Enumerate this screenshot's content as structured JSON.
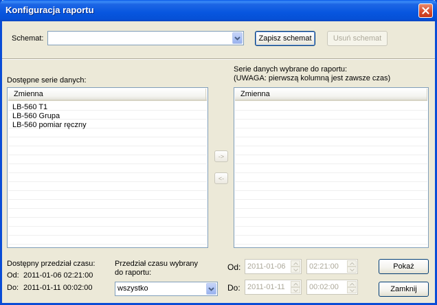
{
  "window": {
    "title": "Konfiguracja raportu"
  },
  "schema": {
    "label": "Schemat:",
    "value": "",
    "save_button": "Zapisz schemat",
    "delete_button": "Usuń schemat"
  },
  "available": {
    "title": "Dostępne serie danych:",
    "column": "Zmienna",
    "items": [
      "LB-560 T1",
      "LB-560 Grupa",
      "LB-560 pomiar ręczny"
    ]
  },
  "selected": {
    "title_line1": "Serie danych wybrane do raportu:",
    "title_line2": "(UWAGA: pierwszą kolumną jest zawsze czas)",
    "column": "Zmienna",
    "items": []
  },
  "transfer": {
    "add": "->",
    "remove": "<-"
  },
  "available_range": {
    "title": "Dostępny przedział czasu:",
    "from_label": "Od:",
    "from_value": "2011-01-06 02:21:00",
    "to_label": "Do:",
    "to_value": "2011-01-11 00:02:00"
  },
  "report_range": {
    "title_line1": "Przedział czasu wybrany",
    "title_line2": "do raportu:",
    "selected": "wszystko"
  },
  "range_inputs": {
    "from_label": "Od:",
    "from_date": "2011-01-06",
    "from_time": "02:21:00",
    "to_label": "Do:",
    "to_date": "2011-01-11",
    "to_time": "00:02:00"
  },
  "actions": {
    "show": "Pokaż",
    "close": "Zamknij"
  }
}
